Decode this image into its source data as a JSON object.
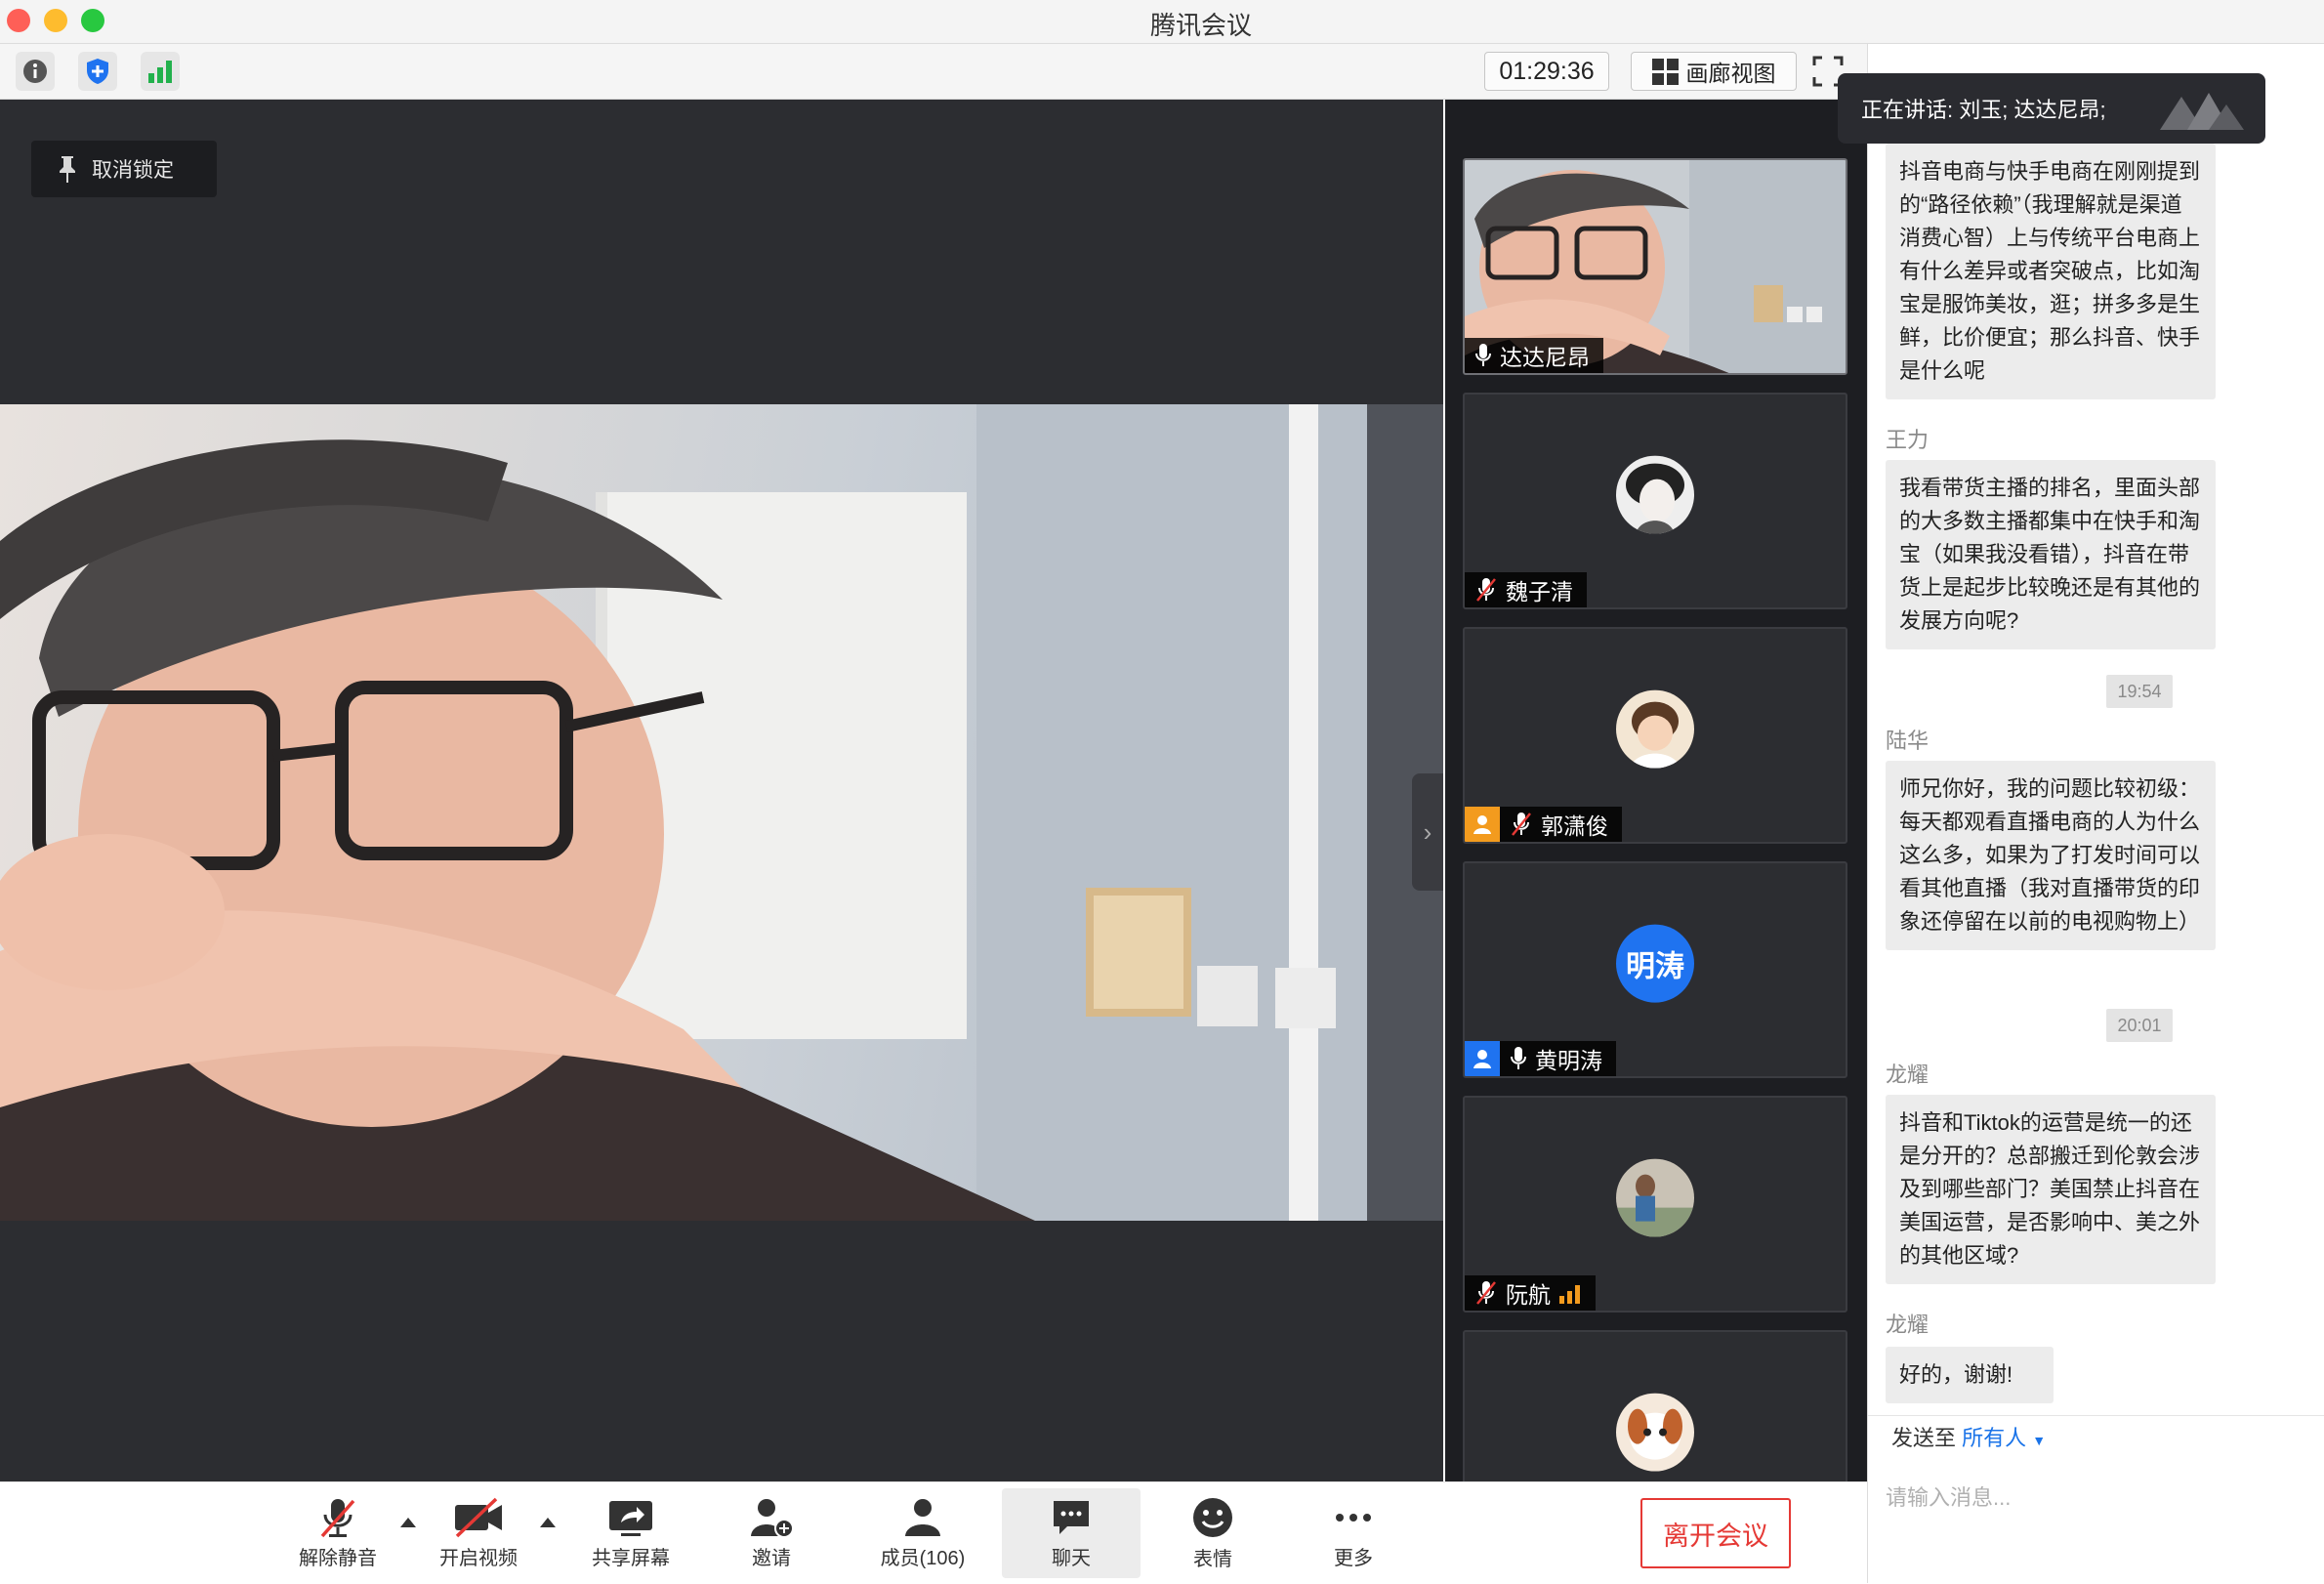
{
  "window": {
    "title": "腾讯会议"
  },
  "toolbar": {
    "timer": "01:29:36",
    "gallery_label": "画廊视图"
  },
  "stage": {
    "unlock_label": "取消锁定"
  },
  "speaking_banner": "正在讲话: 刘玉; 达达尼昂;",
  "gallery": {
    "tiles": [
      {
        "name": "达达尼昂",
        "mic": "on"
      },
      {
        "name": "魏子清",
        "mic": "muted"
      },
      {
        "name": "郭潇俊",
        "mic": "muted",
        "badge": "orange"
      },
      {
        "name": "黄明涛",
        "mic": "on",
        "badge": "blue",
        "avatar_text": "明涛"
      },
      {
        "name": "阮航",
        "mic": "muted"
      }
    ]
  },
  "chat": {
    "messages": [
      {
        "sender": "",
        "text": "抖音电商与快手电商在刚刚提到的“路径依赖”（我理解就是渠道消费心智）上与传统平台电商上有什么差异或者突破点，比如淘宝是服饰美妆，逛；拼多多是生鲜，比价便宜；那么抖音、快手是什么呢"
      },
      {
        "sender": "王力",
        "text": "我看带货主播的排名，里面头部的大多数主播都集中在快手和淘宝（如果我没看错），抖音在带货上是起步比较晚还是有其他的发展方向呢?"
      },
      {
        "time": "19:54"
      },
      {
        "sender": "陆华",
        "text": "师兄你好，我的问题比较初级：每天都观看直播电商的人为什么这么多，如果为了打发时间可以看其他直播（我对直播带货的印象还停留在以前的电视购物上）"
      },
      {
        "time": "20:01"
      },
      {
        "sender": "龙耀",
        "text": "抖音和Tiktok的运营是统一的还是分开的？总部搬迁到伦敦会涉及到哪些部门？美国禁止抖音在美国运营，是否影响中、美之外的其他区域?"
      },
      {
        "sender": "龙耀",
        "text": "好的，谢谢!"
      }
    ],
    "send_to_label": "发送至",
    "send_to_target": "所有人",
    "input_placeholder": "请输入消息..."
  },
  "controls": {
    "unmute": "解除静音",
    "start_video": "开启视频",
    "share_screen": "共享屏幕",
    "invite": "邀请",
    "members": "成员(106)",
    "chat": "聊天",
    "emoji": "表情",
    "more": "更多",
    "leave": "离开会议"
  },
  "colors": {
    "accent_blue": "#1a73e8",
    "leave_red": "#e53935",
    "host_orange": "#f39b1e",
    "host_blue": "#1f73f0",
    "network_green": "#22b14c"
  }
}
